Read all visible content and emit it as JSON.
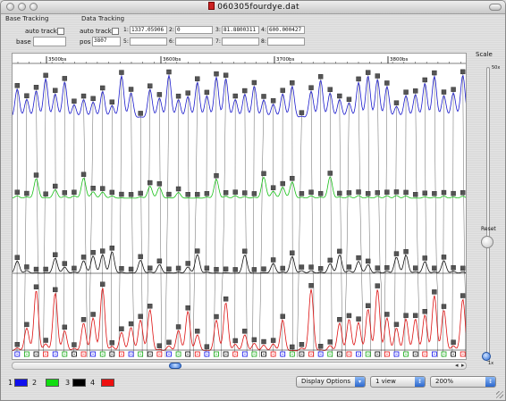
{
  "window": {
    "title": "060305fourdye.dat"
  },
  "base_tracking": {
    "section_label": "Base Tracking",
    "auto_track_label": "auto track",
    "auto_track_checked": false,
    "base_label": "base",
    "base_value": ""
  },
  "data_tracking": {
    "section_label": "Data Tracking",
    "auto_track_label": "auto track",
    "auto_track_checked": false,
    "pos_label": "pos",
    "pos_value": "3807",
    "channels": [
      {
        "label": "1:",
        "value": "1337.05906",
        "sub_label": "5:",
        "sub_value": ""
      },
      {
        "label": "2:",
        "value": "0",
        "sub_label": "6:",
        "sub_value": ""
      },
      {
        "label": "3:",
        "value": "81.8800311",
        "sub_label": "7:",
        "sub_value": ""
      },
      {
        "label": "4:",
        "value": "600.000427",
        "sub_label": "8:",
        "sub_value": ""
      }
    ]
  },
  "ruler": {
    "labels": [
      "3500bs",
      "3600bs",
      "3700bs",
      "3800bs"
    ]
  },
  "traces": {
    "blue": "#1a1acc",
    "green": "#18c018",
    "black": "#111111",
    "red": "#dd1111",
    "connector": "#555555"
  },
  "scale": {
    "label": "Scale",
    "top_value": "50x",
    "reset_label": "Reset",
    "bottom_value": "1x"
  },
  "legend": [
    {
      "num": "1",
      "color": "#1010ee"
    },
    {
      "num": "2",
      "color": "#10dd10"
    },
    {
      "num": "3",
      "color": "#000000"
    },
    {
      "num": "4",
      "color": "#ee1010"
    }
  ],
  "controls": {
    "display_options": "Display Options",
    "view_option": "1 view",
    "zoom_option": "200%"
  }
}
